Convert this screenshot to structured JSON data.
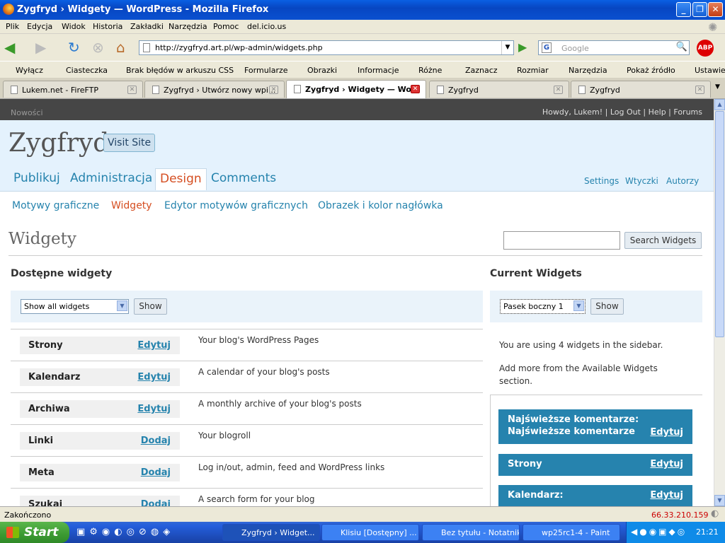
{
  "window": {
    "title": "Zygfryd › Widgety — WordPress - Mozilla Firefox"
  },
  "menu": [
    "Plik",
    "Edycja",
    "Widok",
    "Historia",
    "Zakładki",
    "Narzędzia",
    "Pomoc",
    "del.icio.us"
  ],
  "nav": {
    "url": "http://zygfryd.art.pl/wp-admin/widgets.php",
    "search_placeholder": "Google"
  },
  "bookmarks": [
    "Wyłącz",
    "Ciasteczka",
    "Brak błędów w arkuszu CSS",
    "Formularze",
    "Obrazki",
    "Informacje",
    "Różne",
    "Zaznacz",
    "Rozmiar",
    "Narzędzia",
    "Pokaż źródło",
    "Ustawienia"
  ],
  "tabs": [
    {
      "label": "Lukem.net - FireFTP"
    },
    {
      "label": "Zygfryd › Utwórz nowy wpi..."
    },
    {
      "label": "Zygfryd › Widgety — Wo..."
    },
    {
      "label": "Zygfryd"
    },
    {
      "label": "Zygfryd"
    }
  ],
  "admin": {
    "news": "Nowości",
    "howdy": "Howdy, Lukem!",
    "logout": "Log Out",
    "help": "Help",
    "forums": "Forums"
  },
  "header": {
    "site_name": "Zygfryd",
    "visit_site": "Visit Site"
  },
  "main_tabs": [
    "Publikuj",
    "Administracja",
    "Design",
    "Comments"
  ],
  "right_links": [
    "Settings",
    "Wtyczki",
    "Autorzy"
  ],
  "sub_nav": [
    "Motywy graficzne",
    "Widgety",
    "Edytor motywów graficznych",
    "Obrazek i kolor nagłówka"
  ],
  "page": {
    "title": "Widgety",
    "search_button": "Search Widgets"
  },
  "available": {
    "heading": "Dostępne widgety",
    "filter_value": "Show all widgets",
    "show": "Show",
    "widgets": [
      {
        "name": "Strony",
        "action": "Edytuj",
        "desc": "Your blog's WordPress Pages"
      },
      {
        "name": "Kalendarz",
        "action": "Edytuj",
        "desc": "A calendar of your blog's posts"
      },
      {
        "name": "Archiwa",
        "action": "Edytuj",
        "desc": "A monthly archive of your blog's posts"
      },
      {
        "name": "Linki",
        "action": "Dodaj",
        "desc": "Your blogroll"
      },
      {
        "name": "Meta",
        "action": "Dodaj",
        "desc": "Log in/out, admin, feed and WordPress links"
      },
      {
        "name": "Szukaj",
        "action": "Dodaj",
        "desc": "A search form for your blog"
      }
    ]
  },
  "current": {
    "heading": "Current Widgets",
    "sidebar_value": "Pasek boczny 1",
    "show": "Show",
    "info1": "You are using 4 widgets in the sidebar.",
    "info2": "Add more from the Available Widgets section.",
    "items": [
      {
        "line1": "Najświeższe komentarze:",
        "line2": "Najświeższe komentarze",
        "action": "Edytuj"
      },
      {
        "line1": "Strony",
        "line2": "",
        "action": "Edytuj"
      },
      {
        "line1": "Kalendarz:",
        "line2": "",
        "action": "Edytuj"
      }
    ]
  },
  "status": {
    "text": "Zakończono",
    "ip": "66.33.210.159"
  },
  "taskbar": {
    "start": "Start",
    "tasks": [
      "Zygfryd › Widget...",
      "Klisiu [Dostępny] ...",
      "Bez tytułu - Notatnik",
      "wp25rc1-4 - Paint"
    ],
    "clock": "21:21"
  }
}
